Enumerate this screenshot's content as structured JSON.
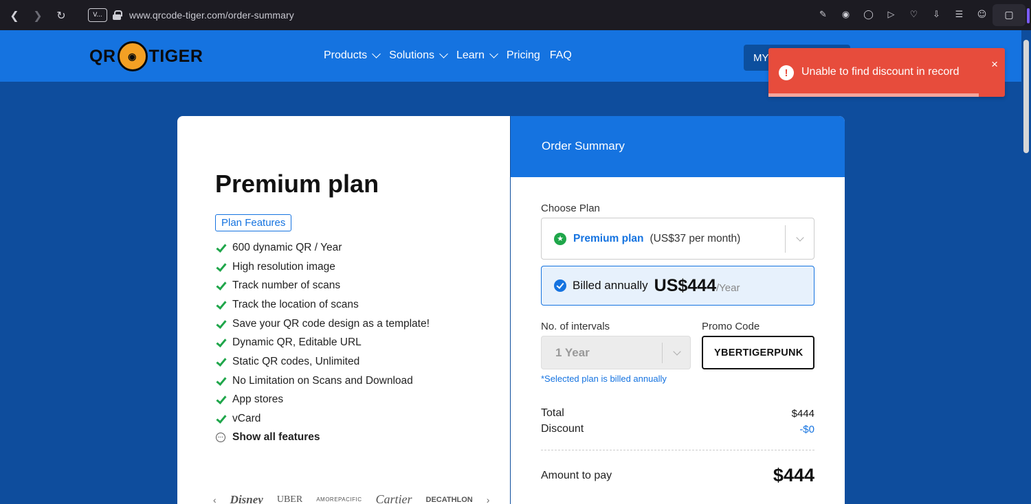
{
  "browser": {
    "url": "www.qrcode-tiger.com/order-summary",
    "tab_chip": "V...",
    "back_icon": "chevron-left-icon",
    "forward_icon": "chevron-right-icon",
    "reload_icon": "reload-icon"
  },
  "header": {
    "logo_left": "QR",
    "logo_right": "TIGER",
    "nav": [
      {
        "label": "Products",
        "has_dropdown": true
      },
      {
        "label": "Solutions",
        "has_dropdown": true
      },
      {
        "label": "Learn",
        "has_dropdown": true
      },
      {
        "label": "Pricing",
        "has_dropdown": false
      },
      {
        "label": "FAQ",
        "has_dropdown": false
      }
    ],
    "my_button": "MY"
  },
  "plan": {
    "title": "Premium plan",
    "features_tag": "Plan Features",
    "features": [
      "600 dynamic QR / Year",
      "High resolution image",
      "Track number of scans",
      "Track the location of scans",
      "Save your QR code design as a template!",
      "Dynamic QR, Editable URL",
      "Static QR codes, Unlimited",
      "No Limitation on Scans and Download",
      "App stores",
      "vCard"
    ],
    "show_all": "Show all features",
    "brands": [
      "Disney",
      "UBER",
      "AMOREPACIFIC",
      "Cartier",
      "DECATHLON"
    ]
  },
  "summary": {
    "title": "Order Summary",
    "choose_plan_label": "Choose Plan",
    "selected_plan_name": "Premium plan",
    "selected_plan_price": "(US$37 per month)",
    "billed_label": "Billed annually",
    "billed_price": "US$444",
    "billed_unit": "/Year",
    "intervals_label": "No. of intervals",
    "interval_value": "1 Year",
    "promo_label": "Promo Code",
    "promo_value": "YBERTIGERPUNK",
    "billed_note": "*Selected plan is billed annually",
    "total_label": "Total",
    "total_value": "$444",
    "discount_label": "Discount",
    "discount_value": "-$0",
    "amount_label": "Amount to pay",
    "amount_value": "$444"
  },
  "toast": {
    "message": "Unable to find discount in record",
    "close_glyph": "×",
    "progress_fraction": 0.89
  },
  "colors": {
    "brand_blue": "#1573e0",
    "page_bg": "#0e4d9d",
    "toast_red": "#e74c3c",
    "check_green": "#1fa64a"
  }
}
